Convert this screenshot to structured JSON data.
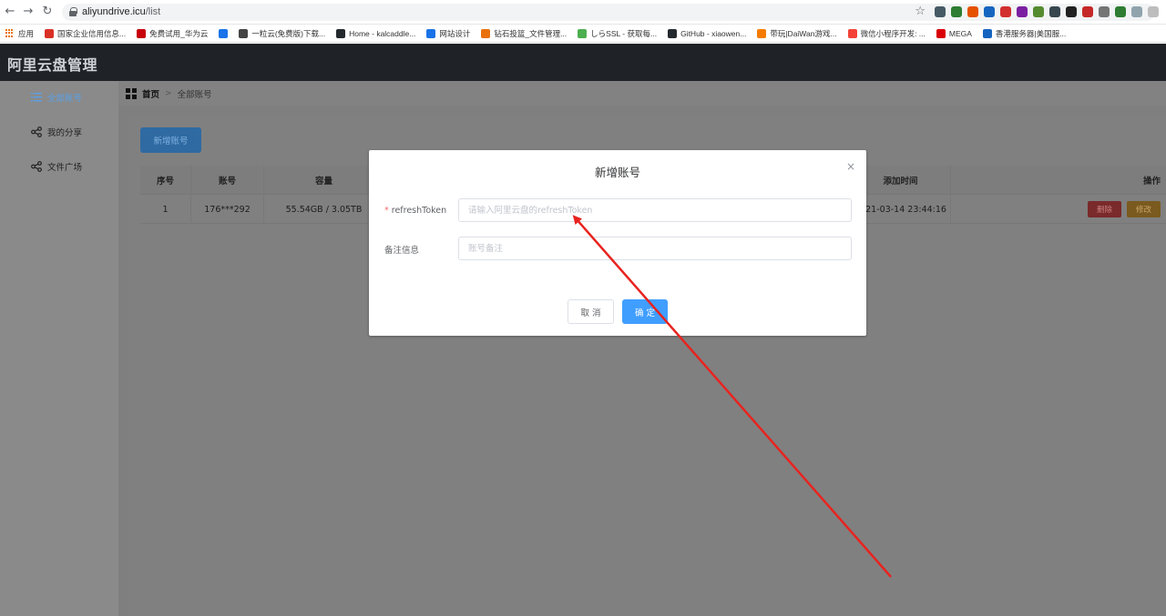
{
  "browser": {
    "url_host": "aliyundrive.icu",
    "url_path": "/list",
    "bookmarks": [
      {
        "label": "应用",
        "color": "#e8710a"
      },
      {
        "label": "国家企业信用信息...",
        "color": "#d93025"
      },
      {
        "label": "免费试用_华为云",
        "color": "#c7000b"
      },
      {
        "label": "",
        "color": "#1a73e8"
      },
      {
        "label": "一粒云(免费版)下载...",
        "color": "#444444"
      },
      {
        "label": "Home - kalcaddle...",
        "color": "#24292e"
      },
      {
        "label": "网站设计",
        "color": "#1a73e8"
      },
      {
        "label": "钻石投篮_文件管理...",
        "color": "#e8710a"
      },
      {
        "label": "しらSSL - 获取每...",
        "color": "#4caf50"
      },
      {
        "label": "GitHub - xiaowen...",
        "color": "#24292e"
      },
      {
        "label": "带玩|DaiWan游戏...",
        "color": "#f57c00"
      },
      {
        "label": "微信小程序开发: ...",
        "color": "#f44336"
      },
      {
        "label": "MEGA",
        "color": "#d90007"
      },
      {
        "label": "香港服务器|美国服...",
        "color": "#1565c0"
      }
    ],
    "extensions": [
      "#455a64",
      "#2e7d32",
      "#e65100",
      "#1565c0",
      "#d32f2f",
      "#7b1fa2",
      "#558b2f",
      "#37474f",
      "#212121",
      "#c62828",
      "#757575",
      "#2e7d32",
      "#90a4ae",
      "#bdbdbd"
    ]
  },
  "app": {
    "title": "阿里云盘管理"
  },
  "sidebar": {
    "items": [
      {
        "label": "全部账号",
        "active": true
      },
      {
        "label": "我的分享",
        "active": false
      },
      {
        "label": "文件广场",
        "active": false
      }
    ]
  },
  "breadcrumb": {
    "home": "首页",
    "separator": ">",
    "current": "全部账号"
  },
  "toolbar": {
    "add_label": "新增账号"
  },
  "table": {
    "headers": [
      "序号",
      "账号",
      "容量",
      "添加时间",
      "操作"
    ],
    "rows": [
      {
        "index": "1",
        "account": "176***292",
        "capacity": "55.54GB / 3.05TB",
        "added": "2021-03-14 23:44:16",
        "delete_label": "删除",
        "edit_label": "修改"
      }
    ]
  },
  "modal": {
    "title": "新增账号",
    "close_glyph": "×",
    "fields": [
      {
        "required_mark": "*",
        "label": "refreshToken",
        "placeholder": "请输入阿里云盘的refreshToken",
        "value": ""
      },
      {
        "required_mark": "",
        "label": "备注信息",
        "placeholder": "账号备注",
        "value": ""
      }
    ],
    "cancel_label": "取 消",
    "confirm_label": "确 定"
  },
  "annotation": {
    "arrow_color": "#e8231f"
  },
  "colors": {
    "primary": "#409eff",
    "danger": "#f56c6c",
    "warning": "#e6a23c",
    "header_bg": "#1f2226"
  }
}
